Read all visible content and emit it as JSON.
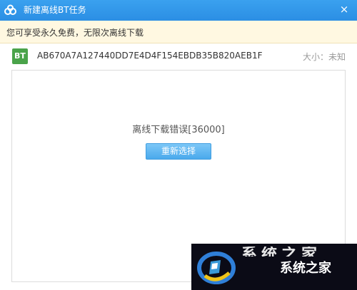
{
  "window": {
    "title": "新建离线BT任务",
    "close_symbol": "×"
  },
  "notice": {
    "text": "您可享受永久免费，无限次离线下载"
  },
  "file": {
    "icon_text": "BT",
    "hash": "AB670A7A127440DD7E4D4F154EBDB35B820AEB1F",
    "size_label": "大小：",
    "size_value": "未知"
  },
  "panel": {
    "error_message": "离线下载错误[36000]",
    "reselect_button": "重新选择"
  },
  "watermark": {
    "top_text": "系统之家",
    "text": "系统之家"
  },
  "colors": {
    "titlebar": "#2b8ee4",
    "notice_bg": "#fff8e1",
    "bt_icon": "#4aa34a",
    "button": "#4aa9ec"
  }
}
